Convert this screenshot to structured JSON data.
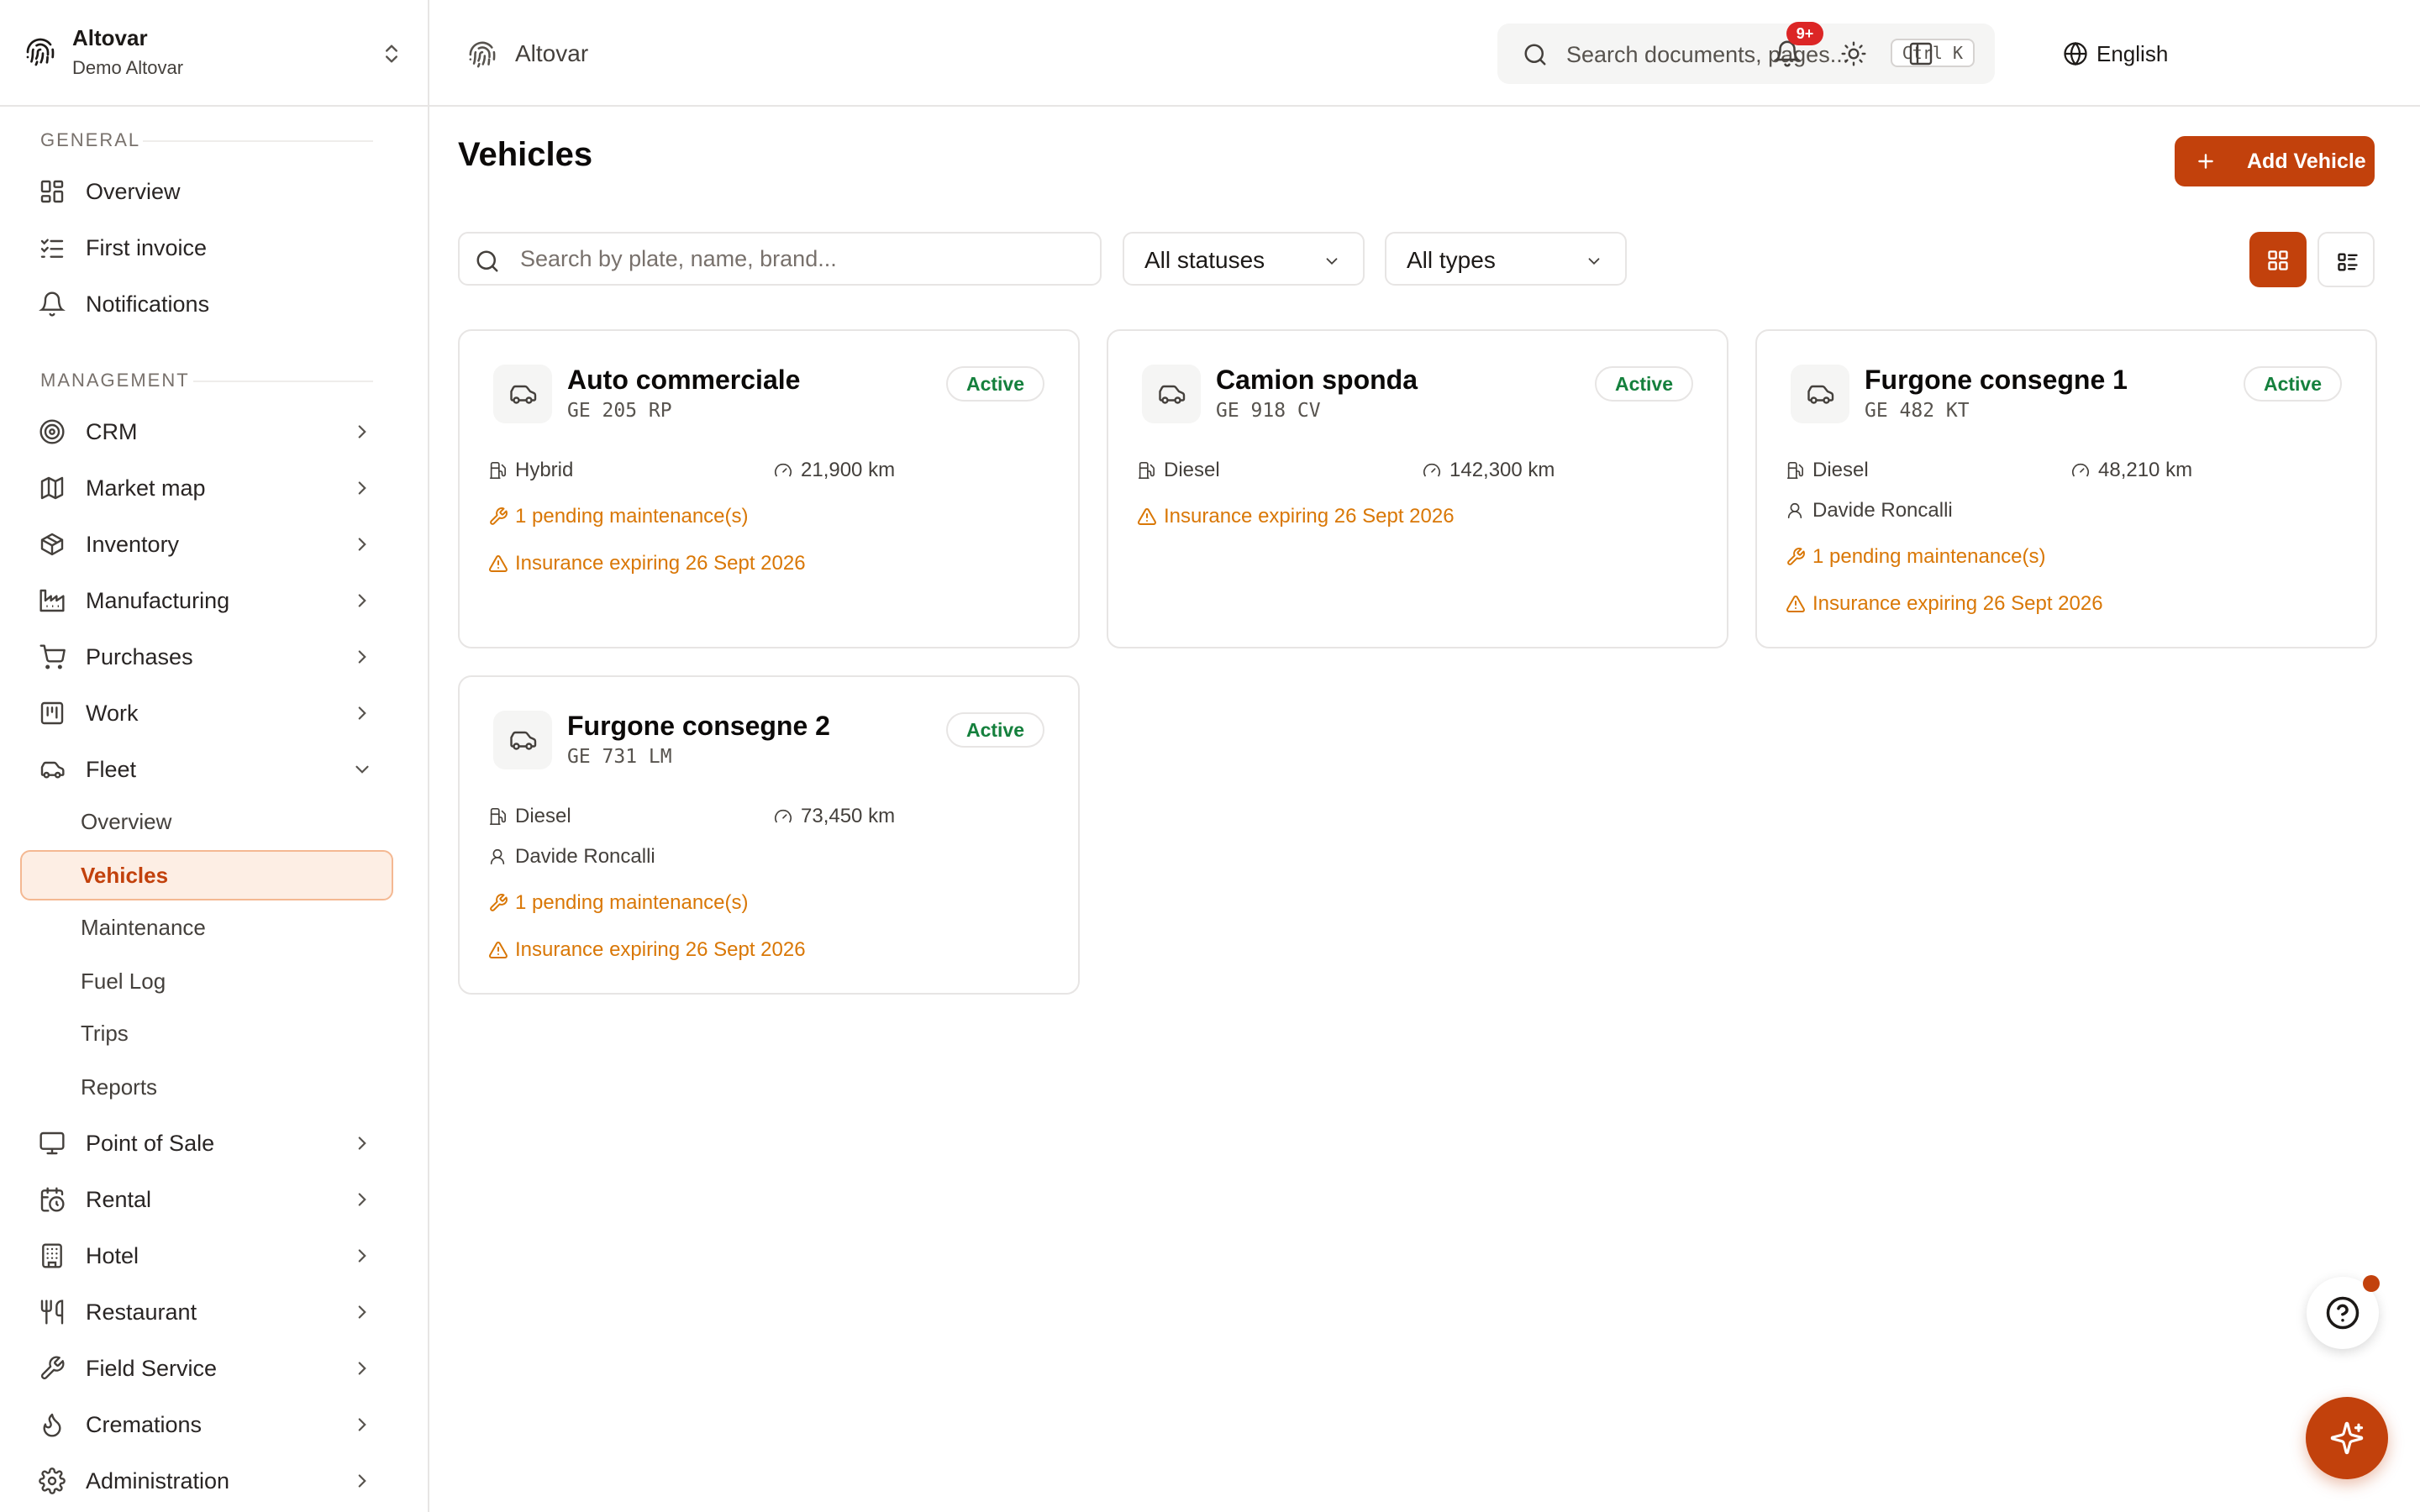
{
  "workspace": {
    "name": "Altovar",
    "subtitle": "Demo Altovar"
  },
  "sidebar": {
    "sections": [
      {
        "label": "GENERAL"
      },
      {
        "label": "MANAGEMENT"
      }
    ],
    "general": [
      {
        "label": "Overview",
        "icon": "dashboard-icon"
      },
      {
        "label": "First invoice",
        "icon": "checklist-icon"
      },
      {
        "label": "Notifications",
        "icon": "bell-icon"
      }
    ],
    "management": [
      {
        "label": "CRM",
        "icon": "target-icon"
      },
      {
        "label": "Market map",
        "icon": "map-icon"
      },
      {
        "label": "Inventory",
        "icon": "package-icon"
      },
      {
        "label": "Manufacturing",
        "icon": "factory-icon"
      },
      {
        "label": "Purchases",
        "icon": "cart-icon"
      },
      {
        "label": "Work",
        "icon": "kanban-icon"
      },
      {
        "label": "Fleet",
        "icon": "car-icon",
        "expanded": true
      },
      {
        "label": "Point of Sale",
        "icon": "monitor-icon"
      },
      {
        "label": "Rental",
        "icon": "calendar-clock-icon"
      },
      {
        "label": "Hotel",
        "icon": "building-icon"
      },
      {
        "label": "Restaurant",
        "icon": "utensils-icon"
      },
      {
        "label": "Field Service",
        "icon": "wrench-icon"
      },
      {
        "label": "Cremations",
        "icon": "flame-icon"
      },
      {
        "label": "Administration",
        "icon": "gear-icon"
      }
    ],
    "fleet_sub": [
      {
        "label": "Overview"
      },
      {
        "label": "Vehicles",
        "active": true
      },
      {
        "label": "Maintenance"
      },
      {
        "label": "Fuel Log"
      },
      {
        "label": "Trips"
      },
      {
        "label": "Reports"
      }
    ]
  },
  "topbar": {
    "title": "Altovar",
    "search_placeholder": "Search documents, pages...",
    "shortcut": "Ctrl K",
    "language": "English",
    "notifications_badge": "9+"
  },
  "page": {
    "title": "Vehicles",
    "add_button": "Add Vehicle",
    "filter_search_placeholder": "Search by plate, name, brand...",
    "status_filter": "All statuses",
    "type_filter": "All types"
  },
  "vehicles": [
    {
      "name": "Auto commerciale",
      "plate": "GE 205 RP",
      "status": "Active",
      "fuel": "Hybrid",
      "mileage": "21,900 km",
      "driver": "",
      "alerts": [
        "1 pending maintenance(s)",
        "Insurance expiring 26 Sept 2026"
      ]
    },
    {
      "name": "Camion sponda",
      "plate": "GE 918 CV",
      "status": "Active",
      "fuel": "Diesel",
      "mileage": "142,300 km",
      "driver": "",
      "alerts": [
        "Insurance expiring 26 Sept 2026"
      ]
    },
    {
      "name": "Furgone consegne 1",
      "plate": "GE 482 KT",
      "status": "Active",
      "fuel": "Diesel",
      "mileage": "48,210 km",
      "driver": "Davide Roncalli",
      "alerts": [
        "1 pending maintenance(s)",
        "Insurance expiring 26 Sept 2026"
      ]
    },
    {
      "name": "Furgone consegne 2",
      "plate": "GE 731 LM",
      "status": "Active",
      "fuel": "Diesel",
      "mileage": "73,450 km",
      "driver": "Davide Roncalli",
      "alerts": [
        "1 pending maintenance(s)",
        "Insurance expiring 26 Sept 2026"
      ]
    }
  ],
  "colors": {
    "accent": "#c2410c",
    "warning": "#d97706",
    "active": "#15803d"
  }
}
